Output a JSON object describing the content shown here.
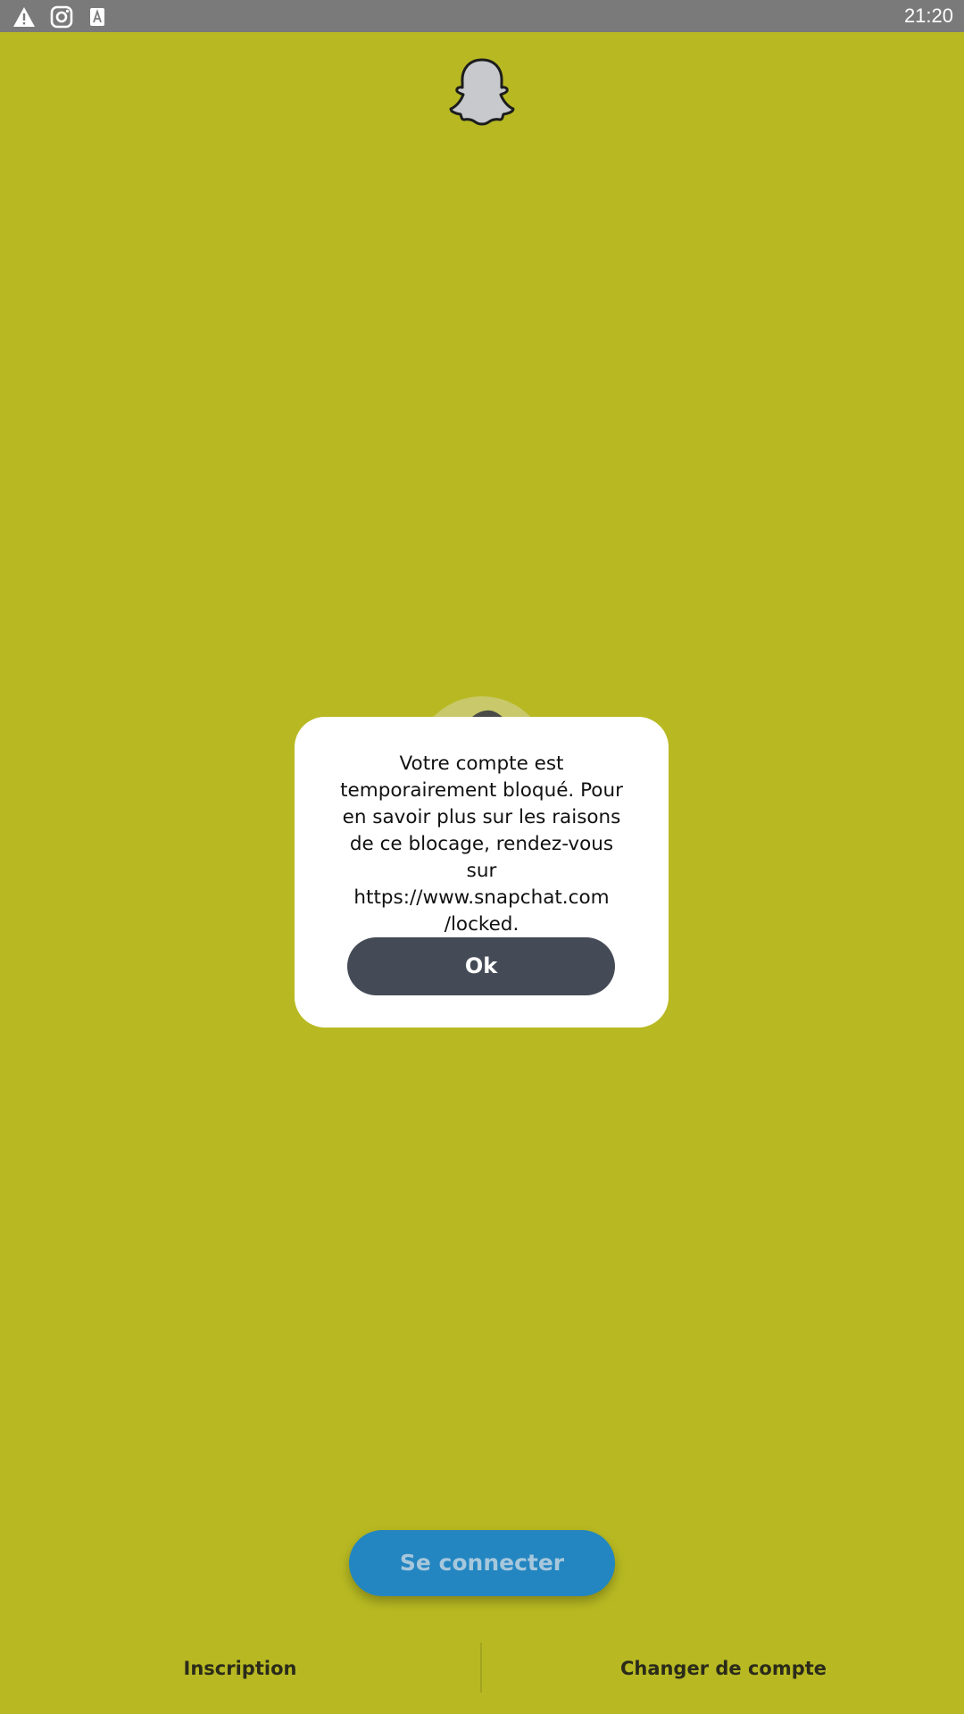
{
  "status_bar": {
    "time": "21:20",
    "icons": [
      "warning-icon",
      "instagram-icon",
      "text-a-icon"
    ],
    "background": "#7a7a7a"
  },
  "app": {
    "background": "#b8b922",
    "logo_icon": "snapchat-ghost-icon"
  },
  "dialog": {
    "message": "Votre compte est\ntemporairement bloqué. Pour\nen savoir plus sur les raisons\nde ce blocage, rendez-vous sur\nhttps://www.snapchat.com\n/locked.",
    "ok_label": "Ok",
    "ok_color": "#454b56"
  },
  "login": {
    "button_label": "Se connecter",
    "button_color": "#2386c1"
  },
  "footer": {
    "signup_label": "Inscription",
    "switch_account_label": "Changer de compte"
  }
}
